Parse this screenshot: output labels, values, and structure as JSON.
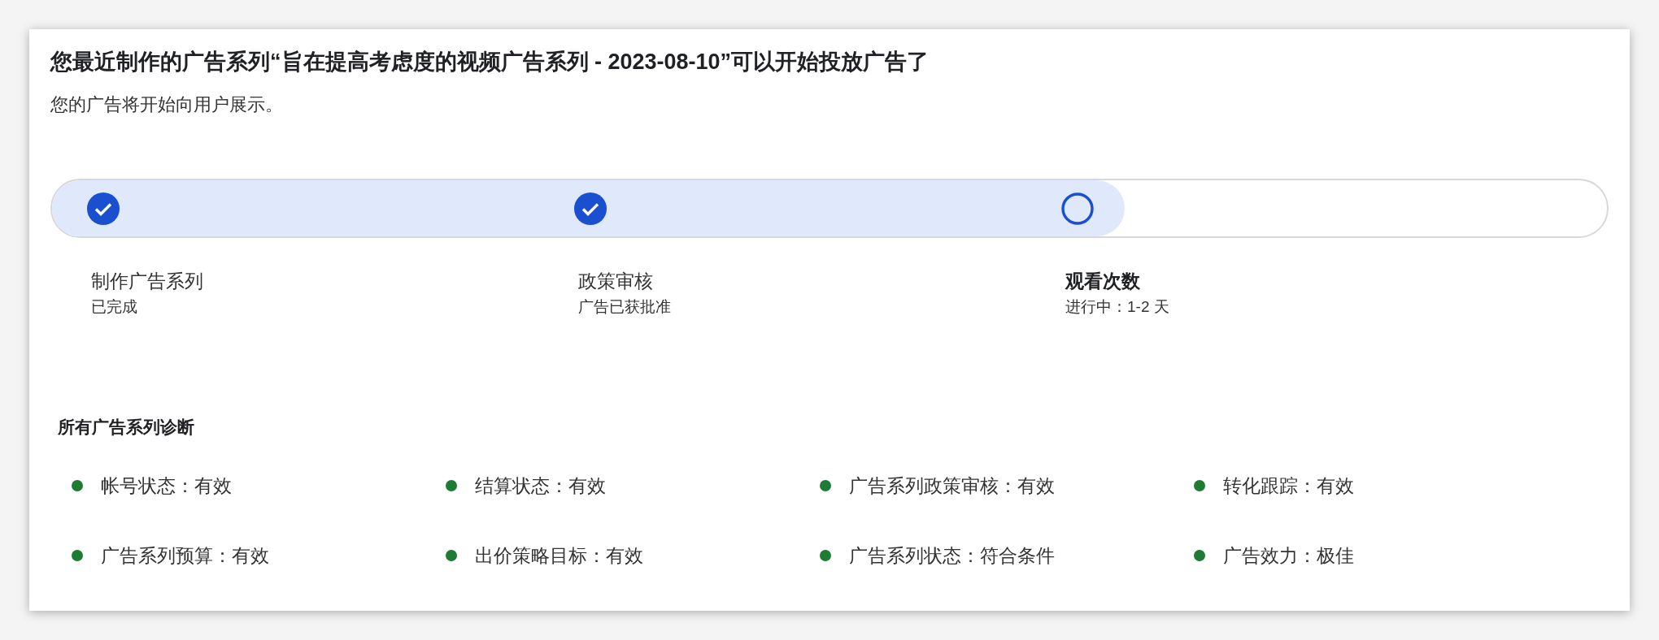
{
  "title": "您最近制作的广告系列“旨在提高考虑度的视频广告系列 - 2023-08-10”可以开始投放广告了",
  "subtitle": "您的广告将开始向用户展示。",
  "progress": {
    "level": 0.69
  },
  "steps": [
    {
      "label": "制作广告系列",
      "detail": "已完成",
      "kind": "done"
    },
    {
      "label": "政策审核",
      "detail": "广告已获批准",
      "kind": "done"
    },
    {
      "label": "观看次数",
      "detail": "进行中：1-2 天",
      "kind": "active"
    }
  ],
  "diagnostics": {
    "heading": "所有广告系列诊断",
    "items": [
      "帐号状态：有效",
      "结算状态：有效",
      "广告系列政策审核：有效",
      "转化跟踪：有效",
      "广告系列预算：有效",
      "出价策略目标：有效",
      "广告系列状态：符合条件",
      "广告效力：极佳"
    ]
  }
}
